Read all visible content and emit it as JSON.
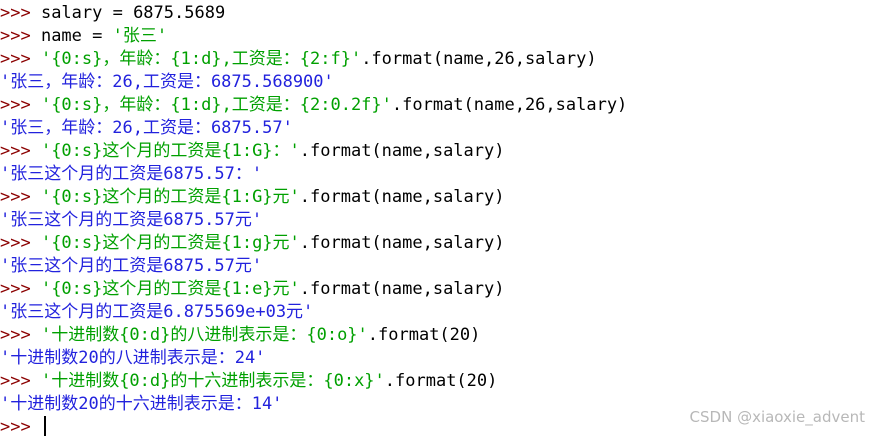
{
  "session": {
    "prompt": ">>> ",
    "lines": [
      {
        "kind": "input",
        "code": "salary = 6875.5689",
        "string": "",
        "tail": ""
      },
      {
        "kind": "input",
        "code": "name = ",
        "string": "'张三'",
        "tail": ""
      },
      {
        "kind": "input",
        "code": "",
        "string": "'{0:s}，年龄：{1:d},工资是：{2:f}'",
        "tail": ".format(name,26,salary)"
      },
      {
        "kind": "output",
        "text": "'张三，年龄：26,工资是：6875.568900'"
      },
      {
        "kind": "input",
        "code": "",
        "string": "'{0:s}，年龄：{1:d},工资是：{2:0.2f}'",
        "tail": ".format(name,26,salary)"
      },
      {
        "kind": "output",
        "text": "'张三，年龄：26,工资是：6875.57'"
      },
      {
        "kind": "input",
        "code": "",
        "string": "'{0:s}这个月的工资是{1:G}：'",
        "tail": ".format(name,salary)"
      },
      {
        "kind": "output",
        "text": "'张三这个月的工资是6875.57：'"
      },
      {
        "kind": "input",
        "code": "",
        "string": "'{0:s}这个月的工资是{1:G}元'",
        "tail": ".format(name,salary)"
      },
      {
        "kind": "output",
        "text": "'张三这个月的工资是6875.57元'"
      },
      {
        "kind": "input",
        "code": "",
        "string": "'{0:s}这个月的工资是{1:g}元'",
        "tail": ".format(name,salary)"
      },
      {
        "kind": "output",
        "text": "'张三这个月的工资是6875.57元'"
      },
      {
        "kind": "input",
        "code": "",
        "string": "'{0:s}这个月的工资是{1:e}元'",
        "tail": ".format(name,salary)"
      },
      {
        "kind": "output",
        "text": "'张三这个月的工资是6.875569e+03元'"
      },
      {
        "kind": "input",
        "code": "",
        "string": "'十进制数{0:d}的八进制表示是：{0:o}'",
        "tail": ".format(20)"
      },
      {
        "kind": "output",
        "text": "'十进制数20的八进制表示是：24'"
      },
      {
        "kind": "input",
        "code": "",
        "string": "'十进制数{0:d}的十六进制表示是：{0:x}'",
        "tail": ".format(20)"
      },
      {
        "kind": "output",
        "text": "'十进制数20的十六进制表示是：14'"
      },
      {
        "kind": "cursor"
      }
    ]
  },
  "watermark": "CSDN @xiaoxie_advent",
  "colors": {
    "prompt": "#8b0000",
    "string": "#00a000",
    "output": "#2222dd",
    "code": "#000000"
  }
}
